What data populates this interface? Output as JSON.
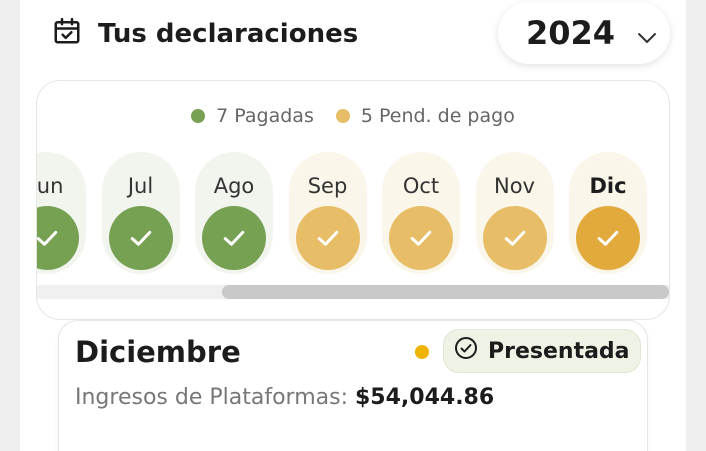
{
  "header": {
    "title": "Tus declaraciones",
    "icon": "calendar-check-icon"
  },
  "year_select": {
    "value": "2024",
    "icon": "chevron-down-icon"
  },
  "legend": {
    "paid": {
      "label": "7 Pagadas",
      "color": "#76a052"
    },
    "pending": {
      "label": "5 Pend. de pago",
      "color": "#e7bd67"
    }
  },
  "months": [
    {
      "label": "Jun",
      "status": "paid"
    },
    {
      "label": "Jul",
      "status": "paid"
    },
    {
      "label": "Ago",
      "status": "paid"
    },
    {
      "label": "Sep",
      "status": "pending"
    },
    {
      "label": "Oct",
      "status": "pending"
    },
    {
      "label": "Nov",
      "status": "pending"
    },
    {
      "label": "Dic",
      "status": "pending",
      "active": true
    }
  ],
  "detail": {
    "month": "Diciembre",
    "status_label": "Presentada",
    "status_dot_color": "#f0b400",
    "income_label": "Ingresos de Plataformas:",
    "income_value": "$54,044.86"
  }
}
